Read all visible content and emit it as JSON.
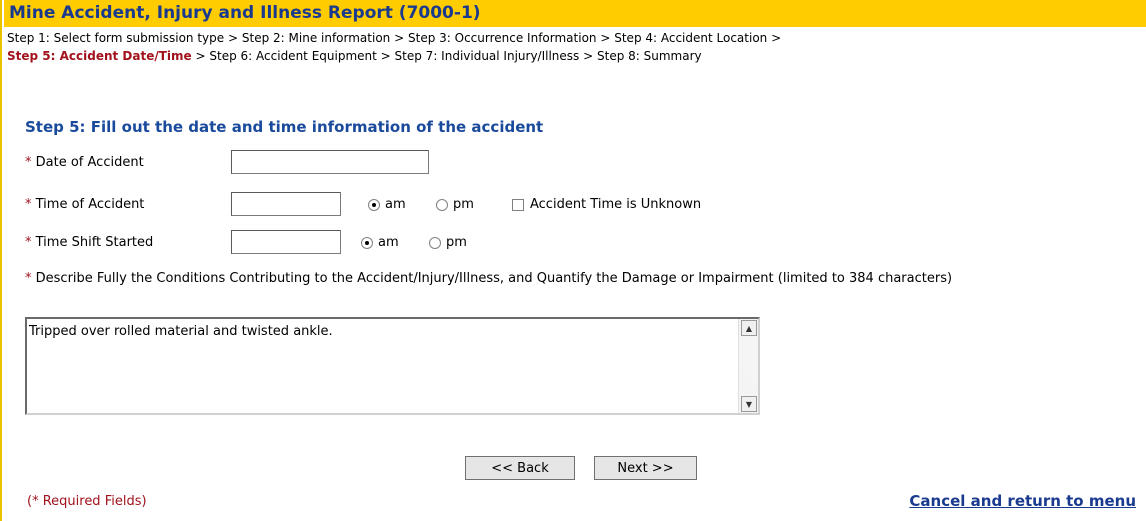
{
  "header": {
    "title": "Mine Accident, Injury and Illness Report (7000-1)"
  },
  "breadcrumb": {
    "step1": "Step 1: Select form submission type",
    "step2": "Step 2: Mine information",
    "step3": "Step 3: Occurrence Information",
    "step4": "Step 4: Accident Location",
    "step5": "Step 5: Accident Date/Time",
    "step6": "Step 6: Accident Equipment",
    "step7": "Step 7: Individual Injury/Illness",
    "step8": "Step 8: Summary",
    "separator": ">"
  },
  "form": {
    "heading": "Step 5: Fill out the date and time information of the accident",
    "required_marker": "*",
    "date_of_accident": {
      "label": "Date of Accident",
      "value": ""
    },
    "time_of_accident": {
      "label": "Time of Accident",
      "value": "",
      "am_label": "am",
      "pm_label": "pm",
      "selected": "am",
      "unknown_label": "Accident Time is Unknown",
      "unknown_checked": false
    },
    "time_shift_started": {
      "label": "Time Shift Started",
      "value": "",
      "am_label": "am",
      "pm_label": "pm",
      "selected": "am"
    },
    "description": {
      "label": "Describe Fully the Conditions Contributing to the Accident/Injury/Illness, and Quantify the Damage or Impairment (limited to 384 characters)",
      "value": "Tripped over rolled material and twisted ankle."
    }
  },
  "buttons": {
    "back": "<< Back",
    "next": "Next >>"
  },
  "footer": {
    "required_note": "(* Required Fields)",
    "cancel_link": "Cancel and return to menu"
  },
  "icons": {
    "scroll_up": "scroll-up-arrow-icon",
    "scroll_down": "scroll-down-arrow-icon"
  },
  "colors": {
    "title_bar": "#ffcc00",
    "title_text": "#1a3a8f",
    "current_step": "#a1121c",
    "heading": "#1a4a9c"
  }
}
